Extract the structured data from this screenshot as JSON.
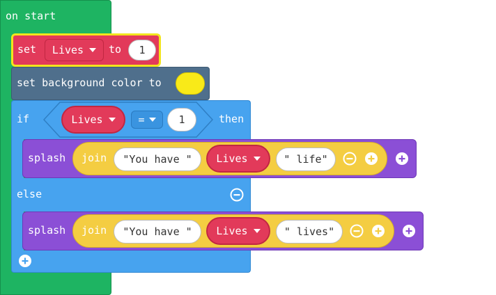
{
  "on_start": {
    "label": "on start"
  },
  "set_block": {
    "set_label": "set",
    "variable": "Lives",
    "to_label": "to",
    "value": "1"
  },
  "bg_block": {
    "label": "set background color to",
    "color": "#f9ea18"
  },
  "if_block": {
    "if_label": "if",
    "condition": {
      "left_var": "Lives",
      "operator": "=",
      "right_value": "1"
    },
    "then_label": "then",
    "else_label": "else"
  },
  "splash1": {
    "label": "splash",
    "join_label": "join",
    "text1": "\"You have \"",
    "var": "Lives",
    "text2": "\" life\""
  },
  "splash2": {
    "label": "splash",
    "join_label": "join",
    "text1": "\"You have \"",
    "var": "Lives",
    "text2": "\" lives\""
  },
  "icons": {
    "minus": "minus-icon",
    "plus": "plus-icon",
    "dropdown": "caret-down-icon"
  }
}
